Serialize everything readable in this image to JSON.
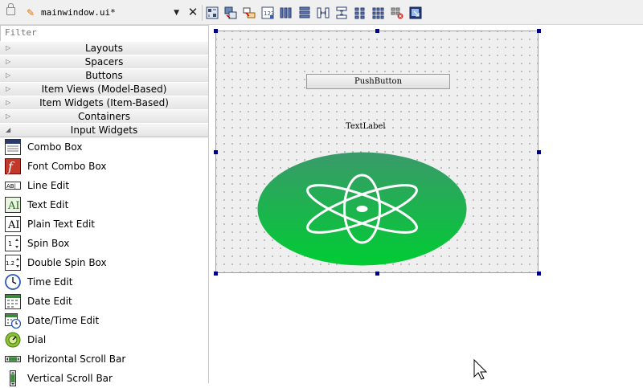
{
  "toolbar": {
    "file_name": "mainwindow.ui*",
    "buttons": [
      "edit-widgets-icon",
      "edit-signals-slots-icon",
      "edit-buddies-icon",
      "edit-tab-order-icon",
      "layout-horizontal-icon",
      "layout-vertical-icon",
      "layout-horizontal-splitter-icon",
      "layout-vertical-splitter-icon",
      "layout-grid-icon",
      "layout-form-icon",
      "break-layout-icon",
      "adjust-size-icon"
    ]
  },
  "widget_box": {
    "filter_placeholder": "Filter",
    "categories": [
      "Layouts",
      "Spacers",
      "Buttons",
      "Item Views (Model-Based)",
      "Item Widgets (Item-Based)",
      "Containers",
      "Input Widgets"
    ],
    "input_widgets": [
      "Combo Box",
      "Font Combo Box",
      "Line Edit",
      "Text Edit",
      "Plain Text Edit",
      "Spin Box",
      "Double Spin Box",
      "Time Edit",
      "Date Edit",
      "Date/Time Edit",
      "Dial",
      "Horizontal Scroll Bar",
      "Vertical Scroll Bar"
    ]
  },
  "form": {
    "push_button": "PushButton",
    "text_label": "TextLabel"
  },
  "colors": {
    "selection_handle": "#000080",
    "ellipse_top": "#3a9a6a",
    "ellipse_bottom": "#00cc33"
  }
}
